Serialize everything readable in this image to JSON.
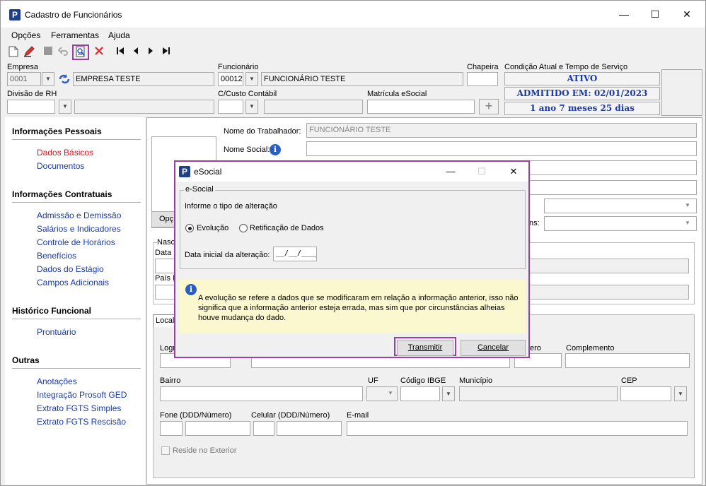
{
  "window": {
    "title": "Cadastro de Funcionários",
    "app_icon_letter": "P",
    "controls": {
      "minimize": "—",
      "maximize": "☐",
      "close": "✕"
    }
  },
  "menu": {
    "opcoes": "Opções",
    "ferramentas": "Ferramentas",
    "ajuda": "Ajuda"
  },
  "toolbar": {
    "icons": [
      "new-document-icon",
      "edit-pencil-icon",
      "stop-icon",
      "undo-icon",
      "esocial-send-icon",
      "delete-x-icon",
      "first-record-icon",
      "previous-record-icon",
      "next-record-icon",
      "last-record-icon"
    ]
  },
  "header": {
    "empresa_label": "Empresa",
    "empresa_code": "0001",
    "empresa_name": "EMPRESA TESTE",
    "divisao_label": "Divisão de RH",
    "divisao_code": "",
    "divisao_name": "",
    "funcionario_label": "Funcionário",
    "funcionario_code": "00012",
    "funcionario_name": "FUNCIONÁRIO TESTE",
    "ccusto_label": "C/Custo Contábil",
    "ccusto_code": "",
    "ccusto_name": "",
    "matricula_label": "Matrícula eSocial",
    "matricula_value": "",
    "chapeira_label": "Chapeira",
    "chapeira_value": "",
    "condicao_label": "Condição Atual e Tempo de Serviço",
    "status": "ATIVO",
    "admitido": "ADMITIDO EM: 02/01/2023",
    "tempo": "1 ano 7 meses 25 dias",
    "add_button": "+"
  },
  "sidebar": {
    "sections": [
      {
        "title": "Informações Pessoais",
        "items": [
          "Dados Básicos",
          "Documentos"
        ]
      },
      {
        "title": "Informações Contratuais",
        "items": [
          "Admissão e Demissão",
          "Salários e Indicadores",
          "Controle de Horários",
          "Benefícios",
          "Dados do Estágio",
          "Campos Adicionais"
        ]
      },
      {
        "title": "Histórico Funcional",
        "items": [
          "Prontuário"
        ]
      },
      {
        "title": "Outras",
        "items": [
          "Anotações",
          "Integração Prosoft GED",
          "Extrato FGTS Simples",
          "Extrato FGTS Rescisão"
        ]
      }
    ],
    "active_item": "Dados Básicos"
  },
  "main": {
    "nome_label": "Nome do Trabalhador:",
    "nome_value": "FUNCIONÁRIO TESTE",
    "nome_social_label": "Nome Social:",
    "nome_social_value": "",
    "opc_button_partial": "Opç",
    "ns_partial": "ns:",
    "nasc_partial": "Nasc",
    "data_partial": "Data",
    "pais_partial": "País N",
    "local_tab_partial": "Local",
    "logr_partial": "Logr",
    "numero_partial": "ero",
    "complemento_label": "Complemento",
    "bairro_label": "Bairro",
    "uf_label": "UF",
    "ibge_label": "Código IBGE",
    "municipio_label": "Município",
    "cep_label": "CEP",
    "fone_label": "Fone (DDD/Número)",
    "celular_label": "Celular (DDD/Número)",
    "email_label": "E-mail",
    "reside_label": "Reside no Exterior"
  },
  "dialog": {
    "title": "eSocial",
    "group_label": "e-Social",
    "prompt": "Informe o tipo de alteração",
    "option_evolucao": "Evolução",
    "option_retificacao": "Retificação de Dados",
    "selected": "Evolução",
    "date_label": "Data inicial da alteração:",
    "date_value": "__/__/____",
    "info_text_1": "A evolução se refere a dados que se modificaram em relação a informação anterior, isso não",
    "info_text_2": "significa que a informação anterior esteja errada, mas sim que por circunstâncias alheias",
    "info_text_3": "houve mudança do dado.",
    "transmitir": "Transmitir",
    "cancelar": "Cancelar",
    "info_bg": "#fbf8d0",
    "highlight_color": "#9b3fa0"
  }
}
